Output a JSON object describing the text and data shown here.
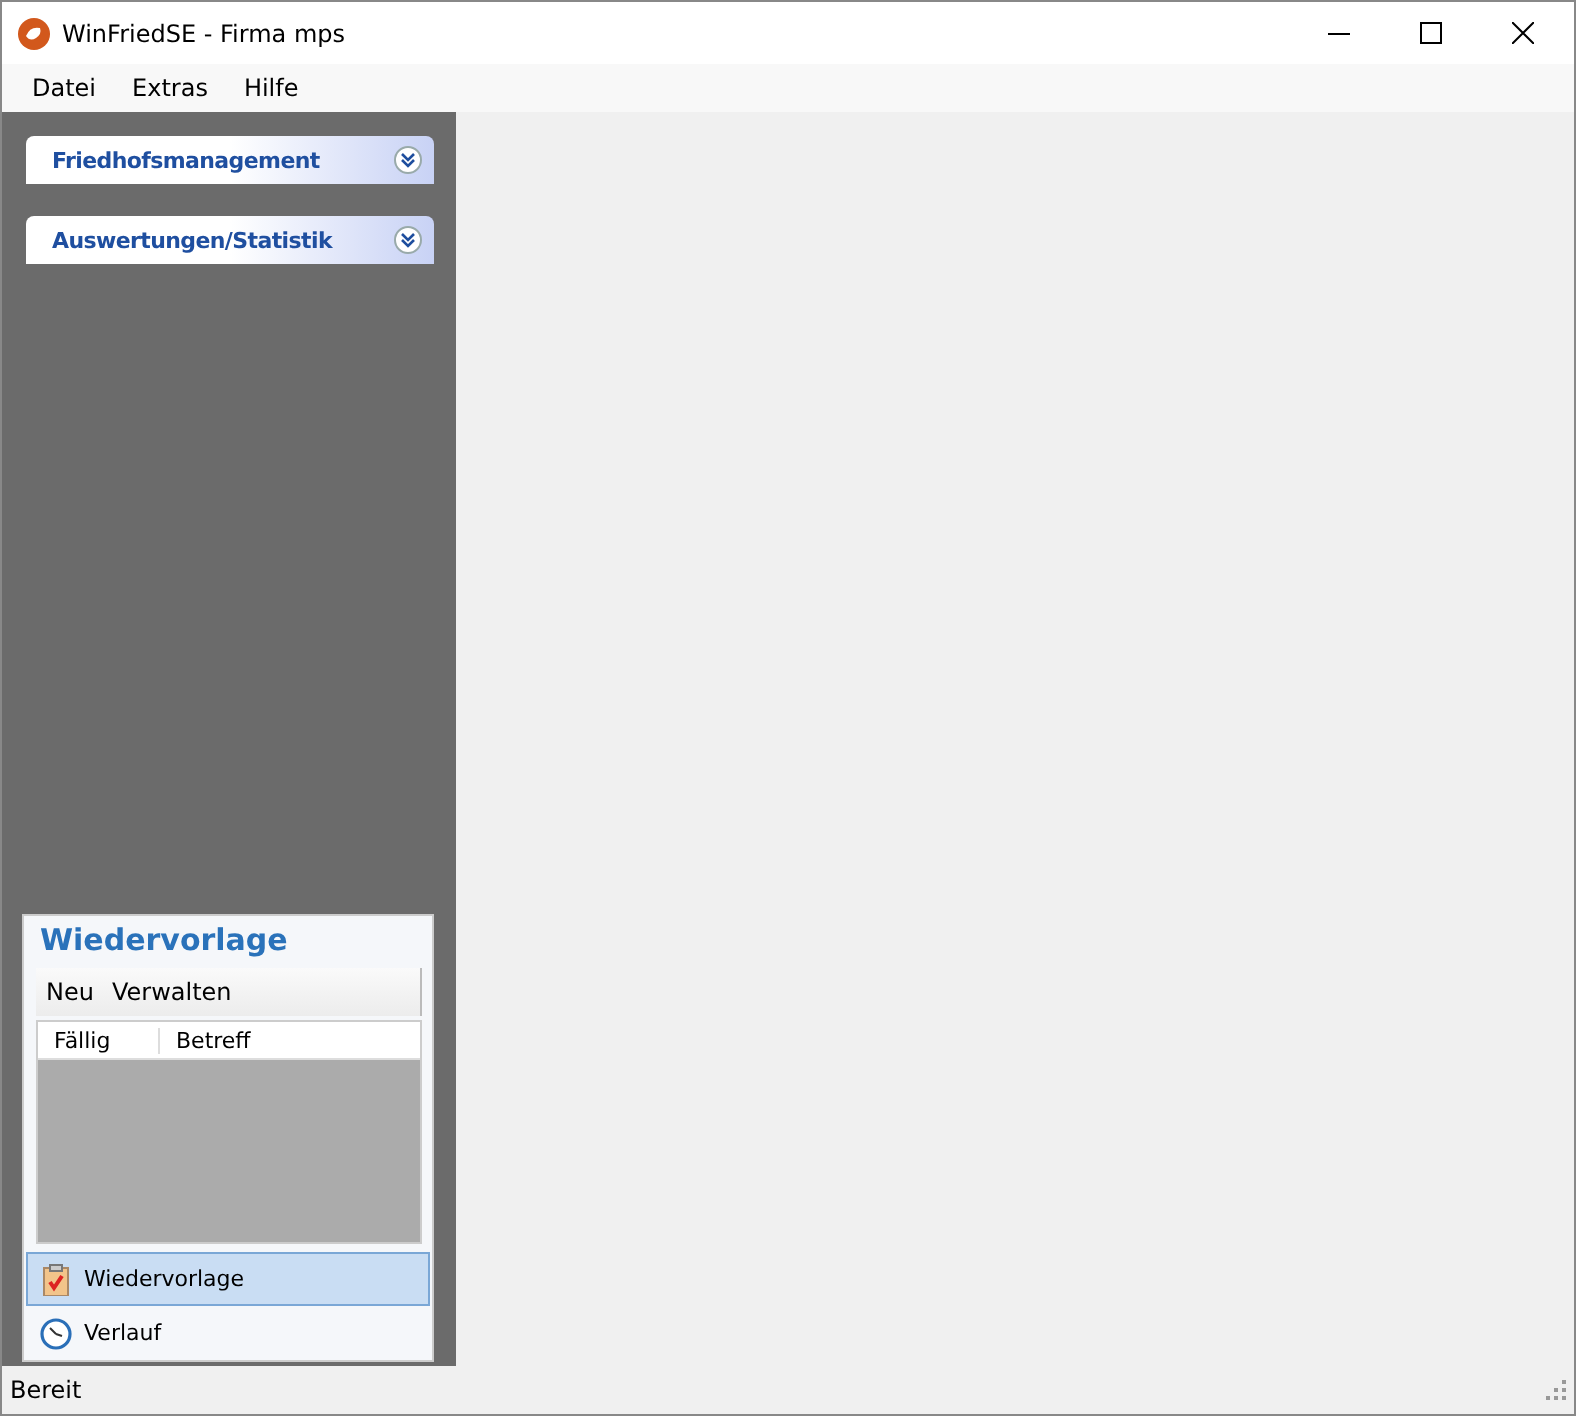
{
  "window": {
    "title": "WinFriedSE - Firma mps"
  },
  "menu": [
    "Datei",
    "Extras",
    "Hilfe"
  ],
  "sidebar": {
    "groups": [
      {
        "label": "Friedhofsmanagement",
        "expanded": false
      },
      {
        "label": "Auswertungen/Statistik",
        "expanded": false
      }
    ]
  },
  "panel": {
    "title": "Wiedervorlage",
    "toolbar": [
      "Neu",
      "Verwalten"
    ],
    "columns": [
      "Fällig",
      "Betreff"
    ],
    "nav": [
      {
        "label": "Wiedervorlage",
        "kind": "clipboard",
        "selected": true
      },
      {
        "label": "Verlauf",
        "kind": "clock",
        "selected": false
      }
    ]
  },
  "status_bar": "Bereit"
}
